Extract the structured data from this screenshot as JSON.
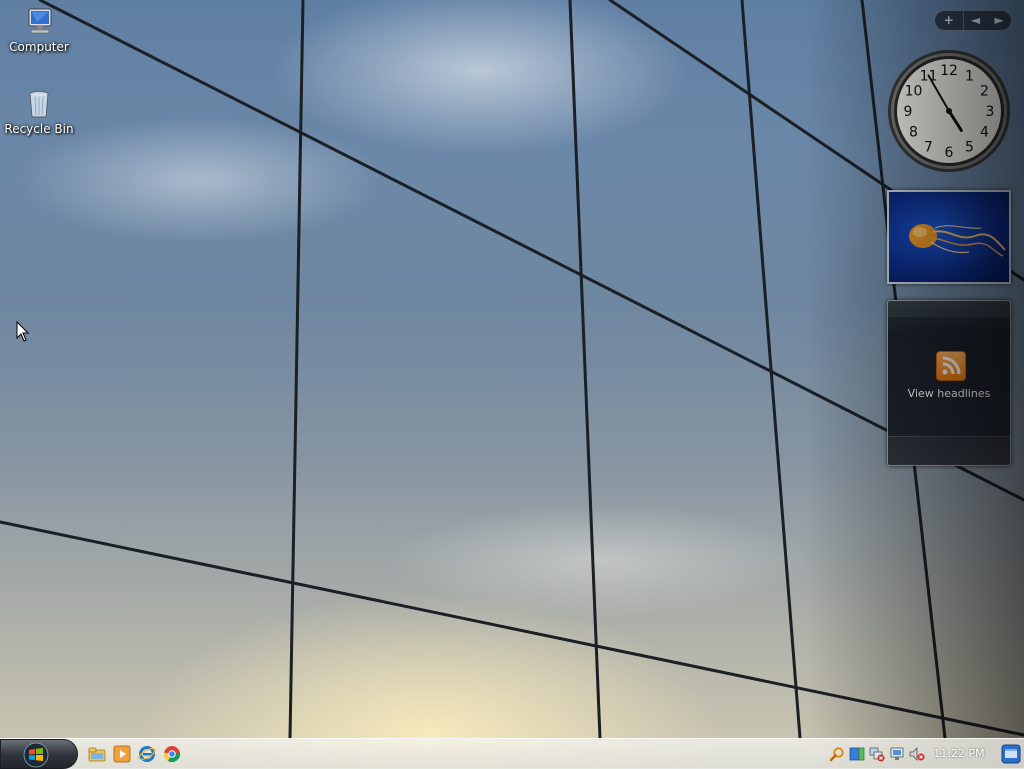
{
  "desktop": {
    "icons": [
      {
        "label": "Computer",
        "icon": "computer-icon"
      },
      {
        "label": "Recycle Bin",
        "icon": "recycle-bin-icon"
      }
    ]
  },
  "sidebar": {
    "controls": {
      "add": "+",
      "prev": "◄",
      "next": "►"
    },
    "clock": {
      "numerals": [
        "12",
        "1",
        "2",
        "3",
        "4",
        "5",
        "6",
        "7",
        "8",
        "9",
        "10",
        "11"
      ],
      "hour": 4,
      "minute": 55
    },
    "slideshow": {
      "subject": "jellyfish"
    },
    "feed": {
      "label": "View headlines",
      "icon": "rss-icon",
      "accent": "#f07a12"
    }
  },
  "taskbar": {
    "start_icon": "windows-logo-icon",
    "quick_launch": [
      "explorer-icon",
      "media-player-icon",
      "internet-explorer-icon",
      "chrome-icon"
    ],
    "tray_icons": [
      "search-icon",
      "sidebar-icon",
      "network-error-icon",
      "network-icon",
      "volume-muted-icon"
    ],
    "clock": "11:22 PM",
    "show_desktop_icon": "show-desktop-icon"
  }
}
